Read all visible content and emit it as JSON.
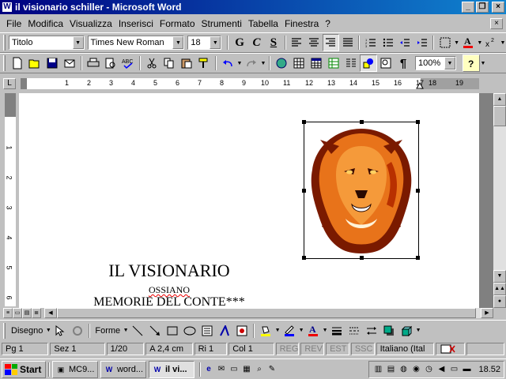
{
  "window": {
    "title": "il visionario schiller - Microsoft Word",
    "app_icon": "W",
    "minimize": "_",
    "restore": "❐",
    "close": "×"
  },
  "menu": {
    "items": [
      "File",
      "Modifica",
      "Visualizza",
      "Inserisci",
      "Formato",
      "Strumenti",
      "Tabella",
      "Finestra",
      "?"
    ],
    "doc_close": "×"
  },
  "formatting_toolbar": {
    "style": "Titolo",
    "font": "Times New Roman",
    "size": "18",
    "bold": "G",
    "italic": "C",
    "underline": "S"
  },
  "standard_toolbar": {
    "zoom": "100%"
  },
  "ruler": {
    "horizontal_ticks": [
      "1",
      "2",
      "3",
      "4",
      "5",
      "6",
      "7",
      "8",
      "9",
      "10",
      "11",
      "12",
      "13",
      "14",
      "15",
      "16",
      "17",
      "18",
      "19"
    ],
    "vertical_ticks": [
      "1",
      "2",
      "3",
      "4",
      "5",
      "6"
    ]
  },
  "document": {
    "title": "IL VISIONARIO",
    "subtitle": "OSSIANO",
    "line3": "MEMORIE DEL CONTE***"
  },
  "drawing_toolbar": {
    "draw_label": "Disegno",
    "shapes_label": "Forme"
  },
  "statusbar": {
    "page": "Pg 1",
    "section": "Sez 1",
    "page_count": "1/20",
    "position": "A  2,4 cm",
    "line": "Ri  1",
    "column": "Col  1",
    "rec": "REG",
    "rev": "REV",
    "ext": "EST",
    "ovr": "SSC",
    "language": "Italiano (Ital"
  },
  "taskbar": {
    "start": "Start",
    "tasks": [
      {
        "label": "MC9...",
        "active": false
      },
      {
        "label": "word...",
        "active": false
      },
      {
        "label": "il vi...",
        "active": true
      }
    ],
    "clock": "18.52"
  },
  "colors": {
    "titlebar_start": "#000080",
    "titlebar_end": "#1084d0",
    "face": "#c0c0c0",
    "lion_orange": "#e8731a",
    "lion_dark": "#7a1a00"
  }
}
